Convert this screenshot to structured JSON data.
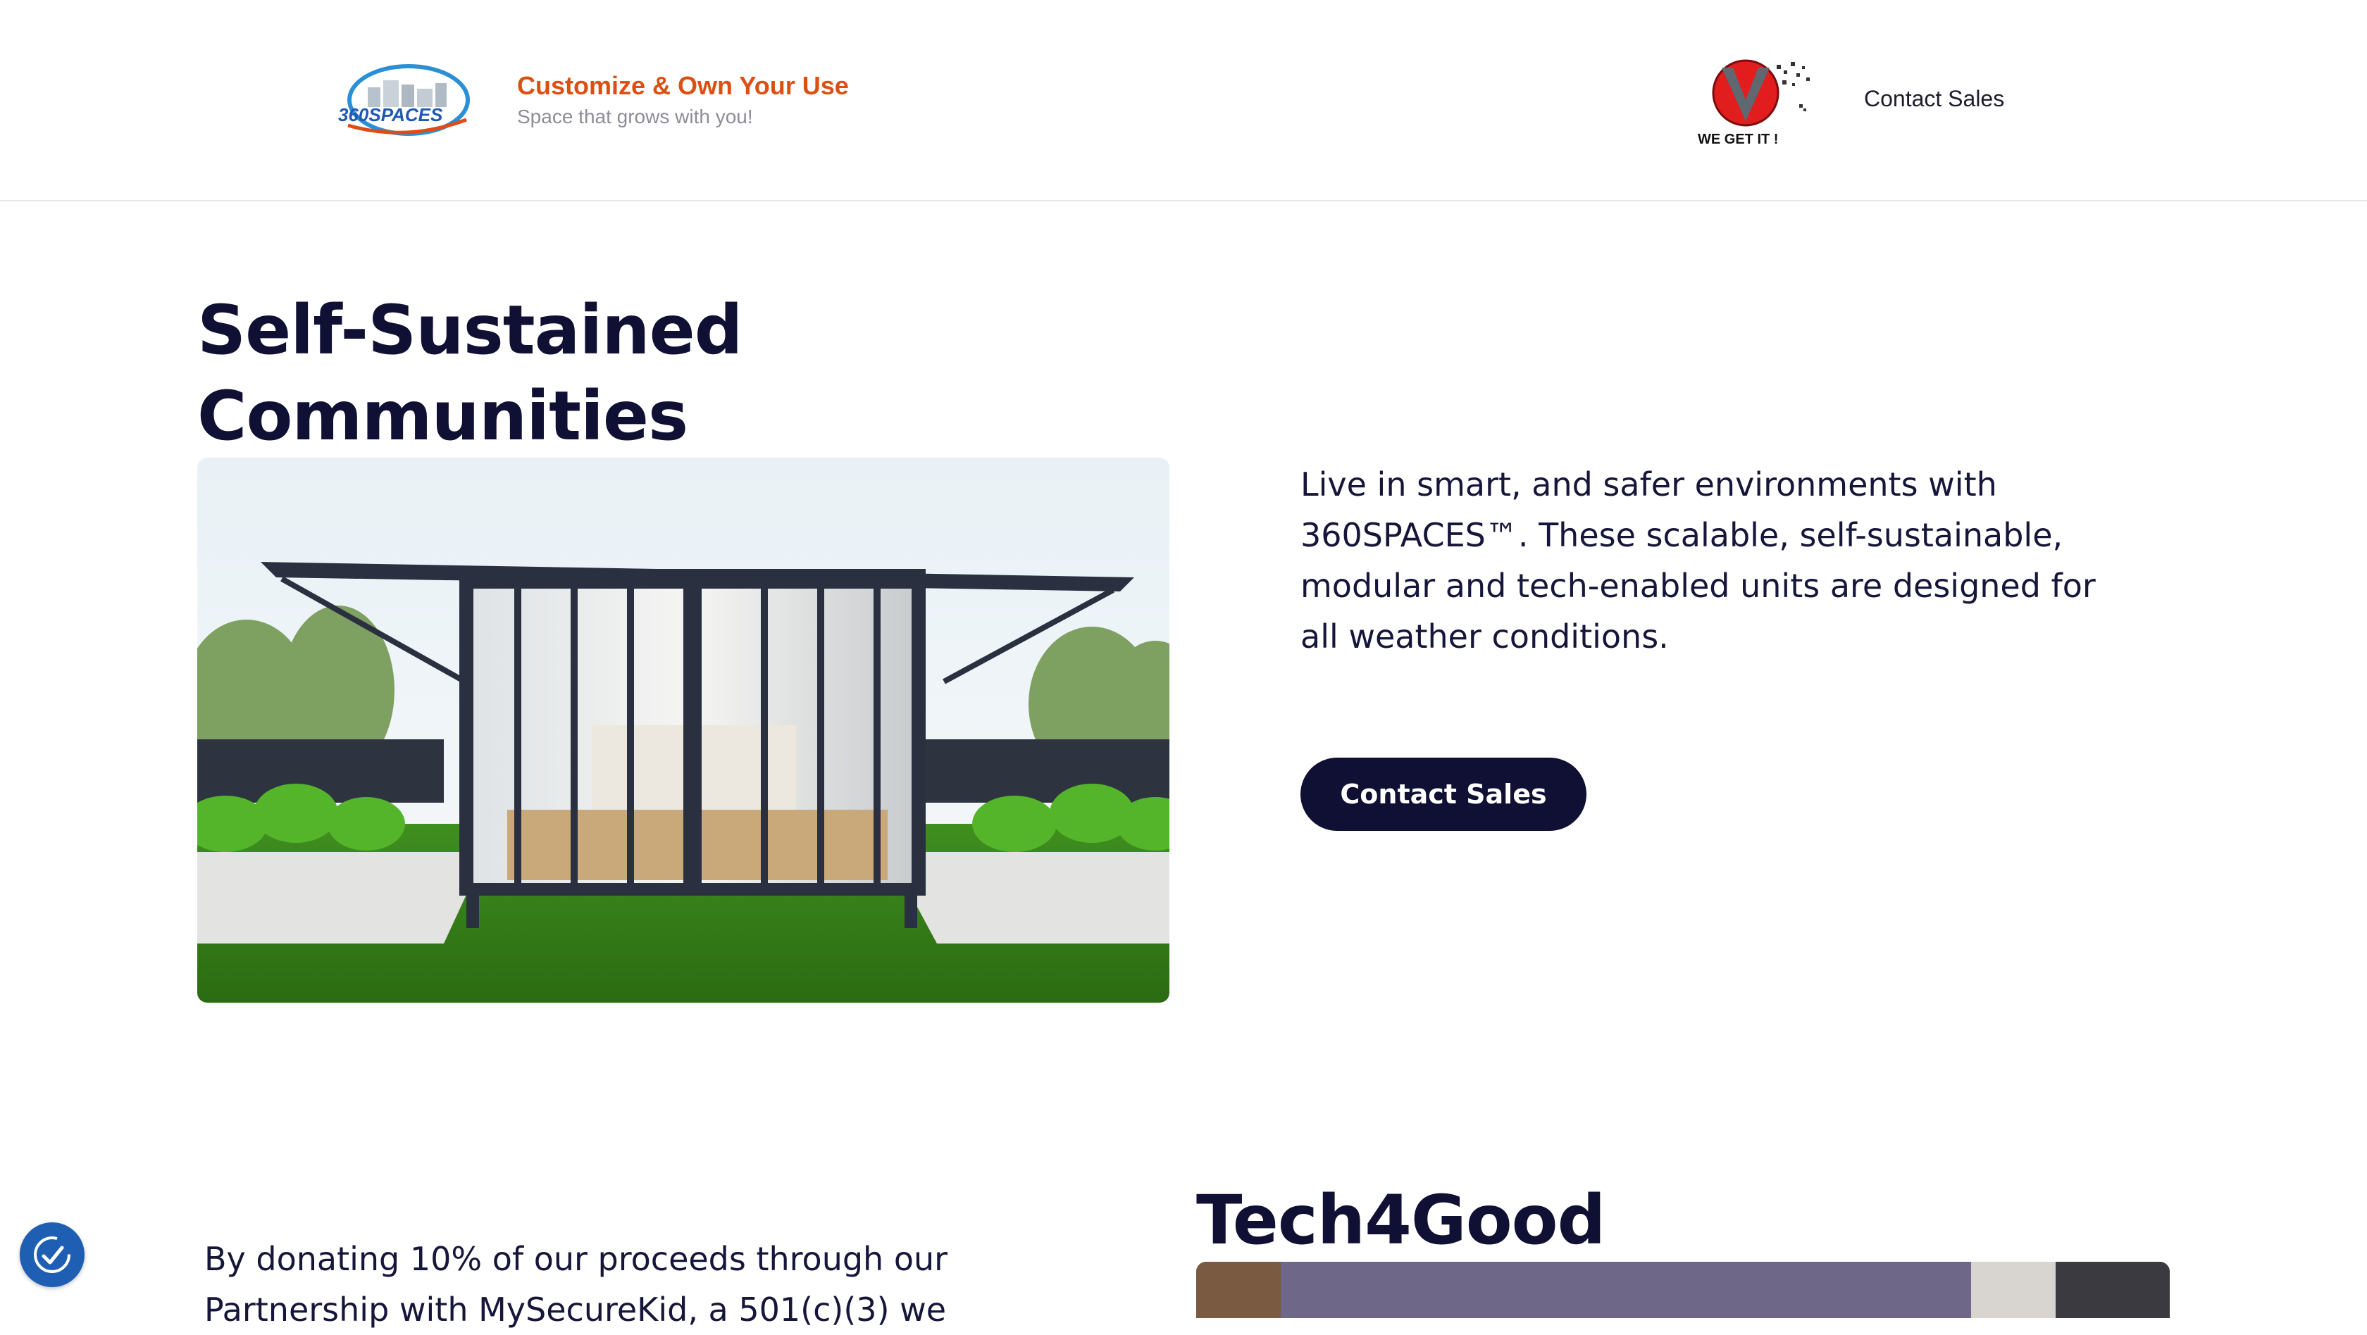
{
  "header": {
    "logo_text": "360SPACES",
    "tagline": "Customize & Own Your Use",
    "subtagline": "Space that grows with you!",
    "partner_logo_text": "WE GET IT !",
    "contact_link": "Contact Sales"
  },
  "hero": {
    "title": "Self-Sustained Communities",
    "description": "Live in smart, and safer environments with 360SPACES™. These scalable, self-sustainable, modular and tech-enabled units are designed for all weather conditions.",
    "cta_label": "Contact Sales"
  },
  "tech4good": {
    "title": "Tech4Good",
    "text": "By donating 10% of our proceeds through our Partnership with MySecureKid, a 501(c)(3) we"
  },
  "colors": {
    "navy": "#0f1033",
    "brand_orange": "#dc4f13",
    "widget_blue": "#1f5fb3"
  },
  "icons": {
    "accessibility": "accessibility-check-icon"
  }
}
